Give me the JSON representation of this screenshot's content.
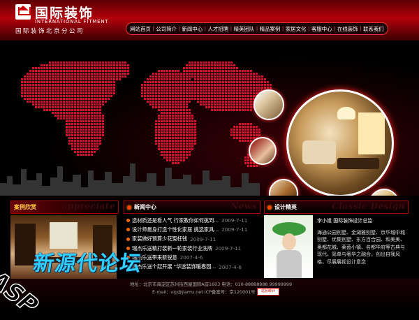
{
  "brand": {
    "name_cn": "国际装饰",
    "name_en": "INTERNATIONAL FITMENT",
    "subtitle": "国际装饰北京分公司"
  },
  "nav": {
    "items": [
      "网站首页",
      "公司简介",
      "新闻中心",
      "人才招聘",
      "精英团队",
      "精品案例",
      "家居文化",
      "客服中心",
      "在线装饰",
      "联系我们"
    ]
  },
  "panels": {
    "cases": {
      "title": "案例欣赏",
      "title_en": "appreciate"
    },
    "news": {
      "title": "新闻中心",
      "title_en": "News",
      "items": [
        {
          "title": "选材质还是看人气 行家教你如何挑到...",
          "date": "2009-7-11"
        },
        {
          "title": "设计师最身打造个性化家居 挑选家具...",
          "date": "2009-7-11"
        },
        {
          "title": "家装做好预算少花冤枉钱",
          "date": "2009-7-11"
        },
        {
          "title": "瑞杰乐送精打装新一轮家装行业洗牌",
          "date": "2009-7-11"
        },
        {
          "title": "瑞杰乐送带来新锐意",
          "date": "2007-4-6"
        },
        {
          "title": "瑞杰乐送个起开展 \"华透装饰暖春园...",
          "date": "2007-4-6"
        }
      ]
    },
    "design": {
      "title": "设计精英",
      "title_en": "Classic Design",
      "name": "李小姐  国际装饰设计总监",
      "bio": "海通公园别墅、金湖雅别墅、京华城中城别墅、优集别墅、东方百合园、和美美、奥都花城、莱茵小镇、名都华府等古典与现代、简单与奢华之融合，创出自我风格，尽展展视设计意念"
    }
  },
  "footer": {
    "line1": "地址：北京市海淀区苏州街西屋国际A座1603  电话：010-88888888  99999999",
    "line2": "E-mail：vip@jiamu.net  ICP备案号：京120001号",
    "badge": "站长统计"
  },
  "overlay": {
    "watermark": "新源代论坛",
    "corner_mark": "ASP"
  },
  "colors": {
    "accent": "#b3000b",
    "nav_border": "#ee3333",
    "watermark": "#2fd0ff"
  }
}
